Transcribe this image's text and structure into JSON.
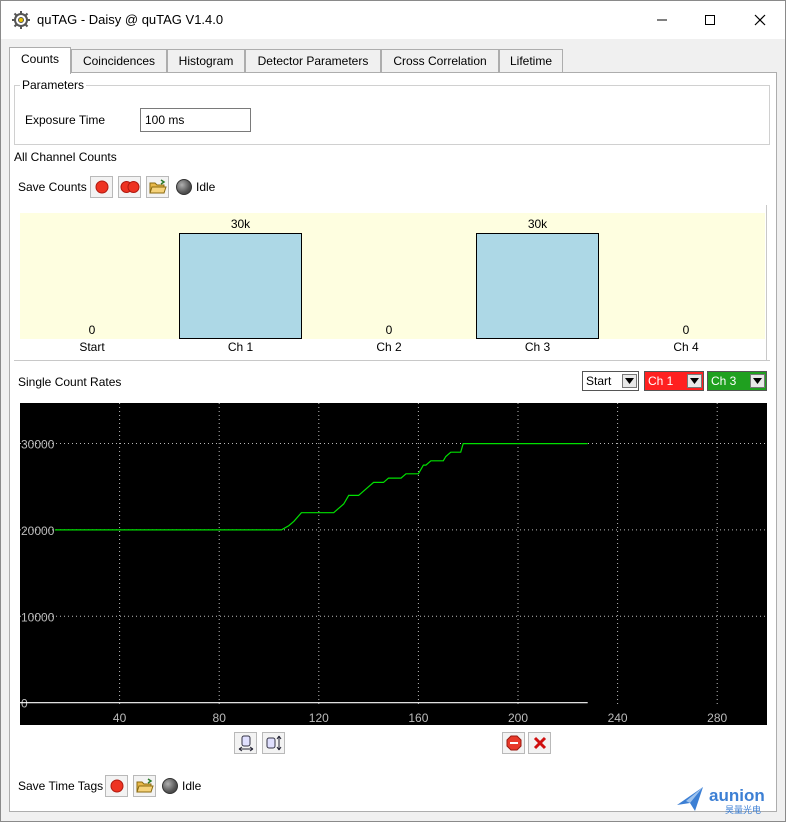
{
  "window": {
    "title": "quTAG - Daisy @ quTAG V1.4.0"
  },
  "tabs": [
    {
      "label": "Counts"
    },
    {
      "label": "Coincidences"
    },
    {
      "label": "Histogram"
    },
    {
      "label": "Detector Parameters"
    },
    {
      "label": "Cross Correlation"
    },
    {
      "label": "Lifetime"
    }
  ],
  "parameters": {
    "group_title": "Parameters",
    "exposure_label": "Exposure Time",
    "exposure_value": "100 ms"
  },
  "all_counts": {
    "title": "All Channel Counts",
    "save_label": "Save Counts",
    "status": "Idle"
  },
  "rates": {
    "title": "Single Count Rates",
    "start_select": "Start",
    "ch1_select": "Ch 1",
    "ch3_select": "Ch 3",
    "colors": {
      "ch1": "#ff2020",
      "ch3": "#1fa01f",
      "line_ch3": "#00e000",
      "line_start": "#ffffff"
    }
  },
  "time_tags": {
    "save_label": "Save Time Tags",
    "status": "Idle"
  },
  "watermark": {
    "brand": "aunion",
    "sub": "昊量光电"
  },
  "chart_data": [
    {
      "type": "bar",
      "categories": [
        "Start",
        "Ch 1",
        "Ch 2",
        "Ch 3",
        "Ch 4"
      ],
      "values": [
        0,
        30000
      ],
      "value_labels": [
        "0",
        "30k",
        "0",
        "30k",
        "0"
      ],
      "all_values": [
        0,
        30000,
        0,
        30000,
        0
      ],
      "ylim": [
        0,
        30000
      ]
    },
    {
      "type": "line",
      "title": "Single Count Rates",
      "xlim": [
        0,
        300
      ],
      "ylim": [
        -500,
        34000
      ],
      "xticks": [
        40,
        80,
        120,
        160,
        200,
        240,
        280
      ],
      "yticks": [
        0,
        10000,
        20000,
        30000
      ],
      "series": [
        {
          "name": "Ch 3",
          "x": [
            14,
            105,
            108,
            110,
            113,
            126,
            128,
            130,
            132,
            136,
            138,
            140,
            142,
            146,
            148,
            150,
            153,
            155,
            158,
            160,
            162,
            163,
            165,
            167,
            170,
            171,
            173,
            175,
            177,
            178,
            180,
            228
          ],
          "y": [
            20000,
            20000,
            20500,
            21000,
            22000,
            22000,
            22500,
            23000,
            24000,
            24000,
            24500,
            25000,
            25500,
            25500,
            26000,
            26000,
            26000,
            26500,
            26500,
            26500,
            27500,
            27500,
            28000,
            28000,
            28000,
            28500,
            29000,
            29000,
            29000,
            30000,
            30000,
            30000
          ]
        },
        {
          "name": "Start",
          "x": [
            0,
            228
          ],
          "y": [
            0,
            0
          ]
        }
      ]
    }
  ]
}
